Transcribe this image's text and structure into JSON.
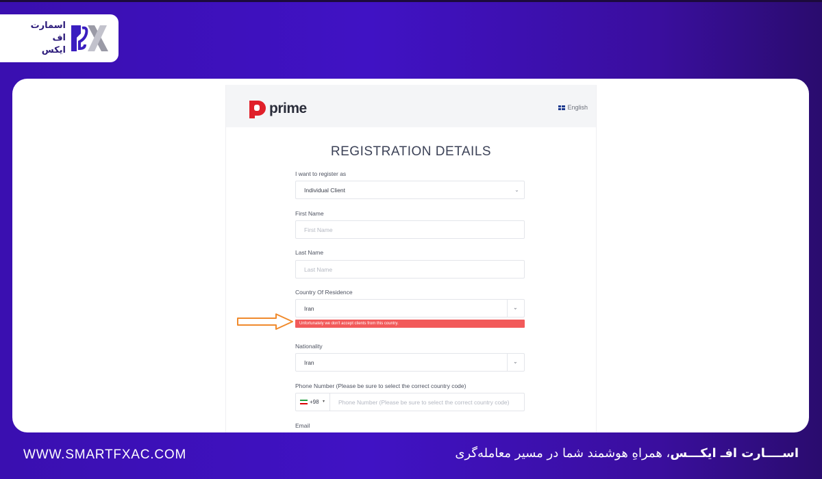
{
  "brand_logo": {
    "lines": [
      "اسمارت",
      "اف",
      "ایکس"
    ]
  },
  "screenshot": {
    "header": {
      "brand_name": "prime",
      "language": "English"
    },
    "title": "REGISTRATION DETAILS",
    "fields": {
      "register_as": {
        "label": "I want to register as",
        "value": "Individual Client"
      },
      "first_name": {
        "label": "First Name",
        "placeholder": "First Name"
      },
      "last_name": {
        "label": "Last Name",
        "placeholder": "Last Name"
      },
      "country": {
        "label": "Country Of Residence",
        "value": "Iran",
        "error": "Unfortunately we don't accept clients from this country."
      },
      "nationality": {
        "label": "Nationality",
        "value": "Iran"
      },
      "phone": {
        "label": "Phone Number (Please be sure to select the correct country code)",
        "prefix": "+98",
        "placeholder": "Phone Number (Please be sure to select the correct country code)"
      },
      "email": {
        "label": "Email"
      }
    }
  },
  "footer": {
    "url": "WWW.SMARTFXAC.COM",
    "tagline_bold": "اســــارت افـ ایکـــس",
    "tagline_rest": "، همراهِ هوشمند شما در مسیر معامله‌گری"
  },
  "colors": {
    "accent": "#3a0fb0",
    "error": "#f25a5a",
    "arrow": "#f08a2c",
    "prime_red": "#e0202a"
  }
}
